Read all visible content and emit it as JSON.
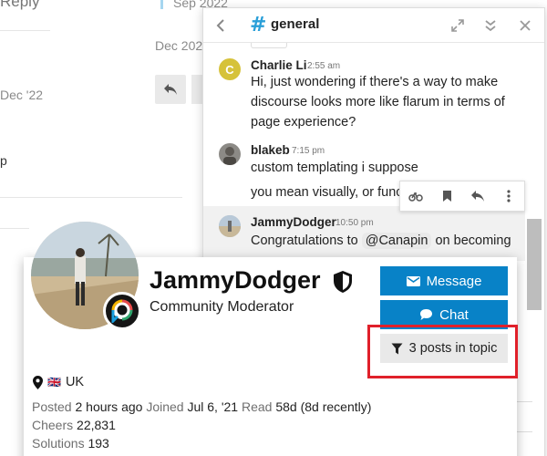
{
  "background": {
    "reply_label": "Reply",
    "date_top": "Sep 2022",
    "date_mid": "Dec 202",
    "date_left": "Dec '22",
    "fragment": "p"
  },
  "chat": {
    "channel_name": "general",
    "messages": [
      {
        "username": "Charlie Li",
        "avatar_letter": "C",
        "time": "2:55 am",
        "lines": [
          "Hi, just wondering if there's a way to make",
          "discourse looks more like flarum in terms of",
          "page experience?"
        ]
      },
      {
        "username": "blakeb",
        "time": "7:15 pm",
        "lines": [
          "custom templating i suppose"
        ]
      },
      {
        "username": "",
        "time": "",
        "lines": [
          "you mean visually, or funct"
        ]
      },
      {
        "username": "JammyDodger",
        "time": "10:50 pm",
        "text_before": "Congratulations to",
        "mention": "@Canapin",
        "text_after": "on becoming"
      }
    ],
    "actions": [
      "bike-icon",
      "bookmark-icon",
      "reply-icon",
      "more-icon"
    ]
  },
  "user_card": {
    "username": "JammyDodger",
    "title": "Community Moderator",
    "buttons": {
      "message": "Message",
      "chat": "Chat",
      "filter": "3 posts in topic"
    },
    "location": "UK",
    "flag": "🇬🇧",
    "stats": {
      "posted_label": "Posted",
      "posted_value": "2 hours ago",
      "joined_label": "Joined",
      "joined_value": "Jul 6, '21",
      "read_label": "Read",
      "read_value": "58d (8d recently)",
      "cheers_label": "Cheers",
      "cheers_value": "22,831",
      "solutions_label": "Solutions",
      "solutions_value": "193"
    },
    "colors": {
      "primary": "#0882c7",
      "highlight": "#e0202a"
    }
  }
}
